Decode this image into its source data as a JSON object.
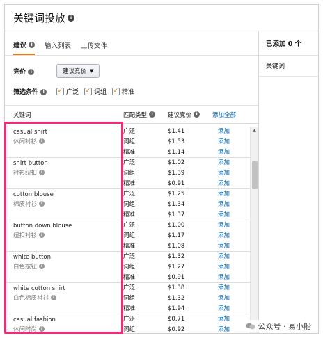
{
  "header": {
    "title": "关键词投放"
  },
  "tabs": [
    {
      "label": "建议",
      "active": true
    },
    {
      "label": "输入列表",
      "active": false
    },
    {
      "label": "上传文件",
      "active": false
    }
  ],
  "bid": {
    "label": "竞价",
    "dropdown_value": "建议竞价"
  },
  "filters": {
    "label": "筛选条件",
    "options": [
      {
        "label": "广泛",
        "checked": true
      },
      {
        "label": "词组",
        "checked": true
      },
      {
        "label": "精准",
        "checked": true
      }
    ]
  },
  "table": {
    "col_keyword": "关键词",
    "col_match": "匹配类型",
    "col_bid": "建议竞价",
    "add_all": "添加全部",
    "add_label": "添加",
    "rows": [
      {
        "keyword": "casual shirt",
        "translation": "休闲衬衫",
        "types": [
          "广泛",
          "词组",
          "精准"
        ],
        "bids": [
          "$1.41",
          "$1.53",
          "$1.14"
        ]
      },
      {
        "keyword": "shirt button",
        "translation": "衬衫纽扣",
        "types": [
          "广泛",
          "词组",
          "精准"
        ],
        "bids": [
          "$1.02",
          "$1.39",
          "$0.91"
        ]
      },
      {
        "keyword": "cotton blouse",
        "translation": "棉质衬衫",
        "types": [
          "广泛",
          "词组",
          "精准"
        ],
        "bids": [
          "$1.25",
          "$1.34",
          "$1.37"
        ]
      },
      {
        "keyword": "button down blouse",
        "translation": "纽扣衬衫",
        "types": [
          "广泛",
          "词组",
          "精准"
        ],
        "bids": [
          "$1.00",
          "$1.17",
          "$1.08"
        ]
      },
      {
        "keyword": "white button",
        "translation": "白色按钮",
        "types": [
          "广泛",
          "词组",
          "精准"
        ],
        "bids": [
          "$1.32",
          "$1.27",
          "$0.91"
        ]
      },
      {
        "keyword": "white cotton shirt",
        "translation": "白色棉质衬衫",
        "types": [
          "广泛",
          "词组",
          "精准"
        ],
        "bids": [
          "$1.38",
          "$1.32",
          "$1.94"
        ]
      },
      {
        "keyword": "casual fashion",
        "translation": "休闲时尚",
        "types": [
          "广泛",
          "词组",
          "精准"
        ],
        "bids": [
          "$0.71",
          "$0.92",
          ""
        ]
      }
    ]
  },
  "right_panel": {
    "title": "已添加 0 个",
    "col_keyword": "关键词"
  },
  "watermark": {
    "text": "公众号 · 易小船"
  },
  "colors": {
    "accent": "#e47911",
    "link": "#0066c0",
    "highlight": "#ee2c78"
  }
}
